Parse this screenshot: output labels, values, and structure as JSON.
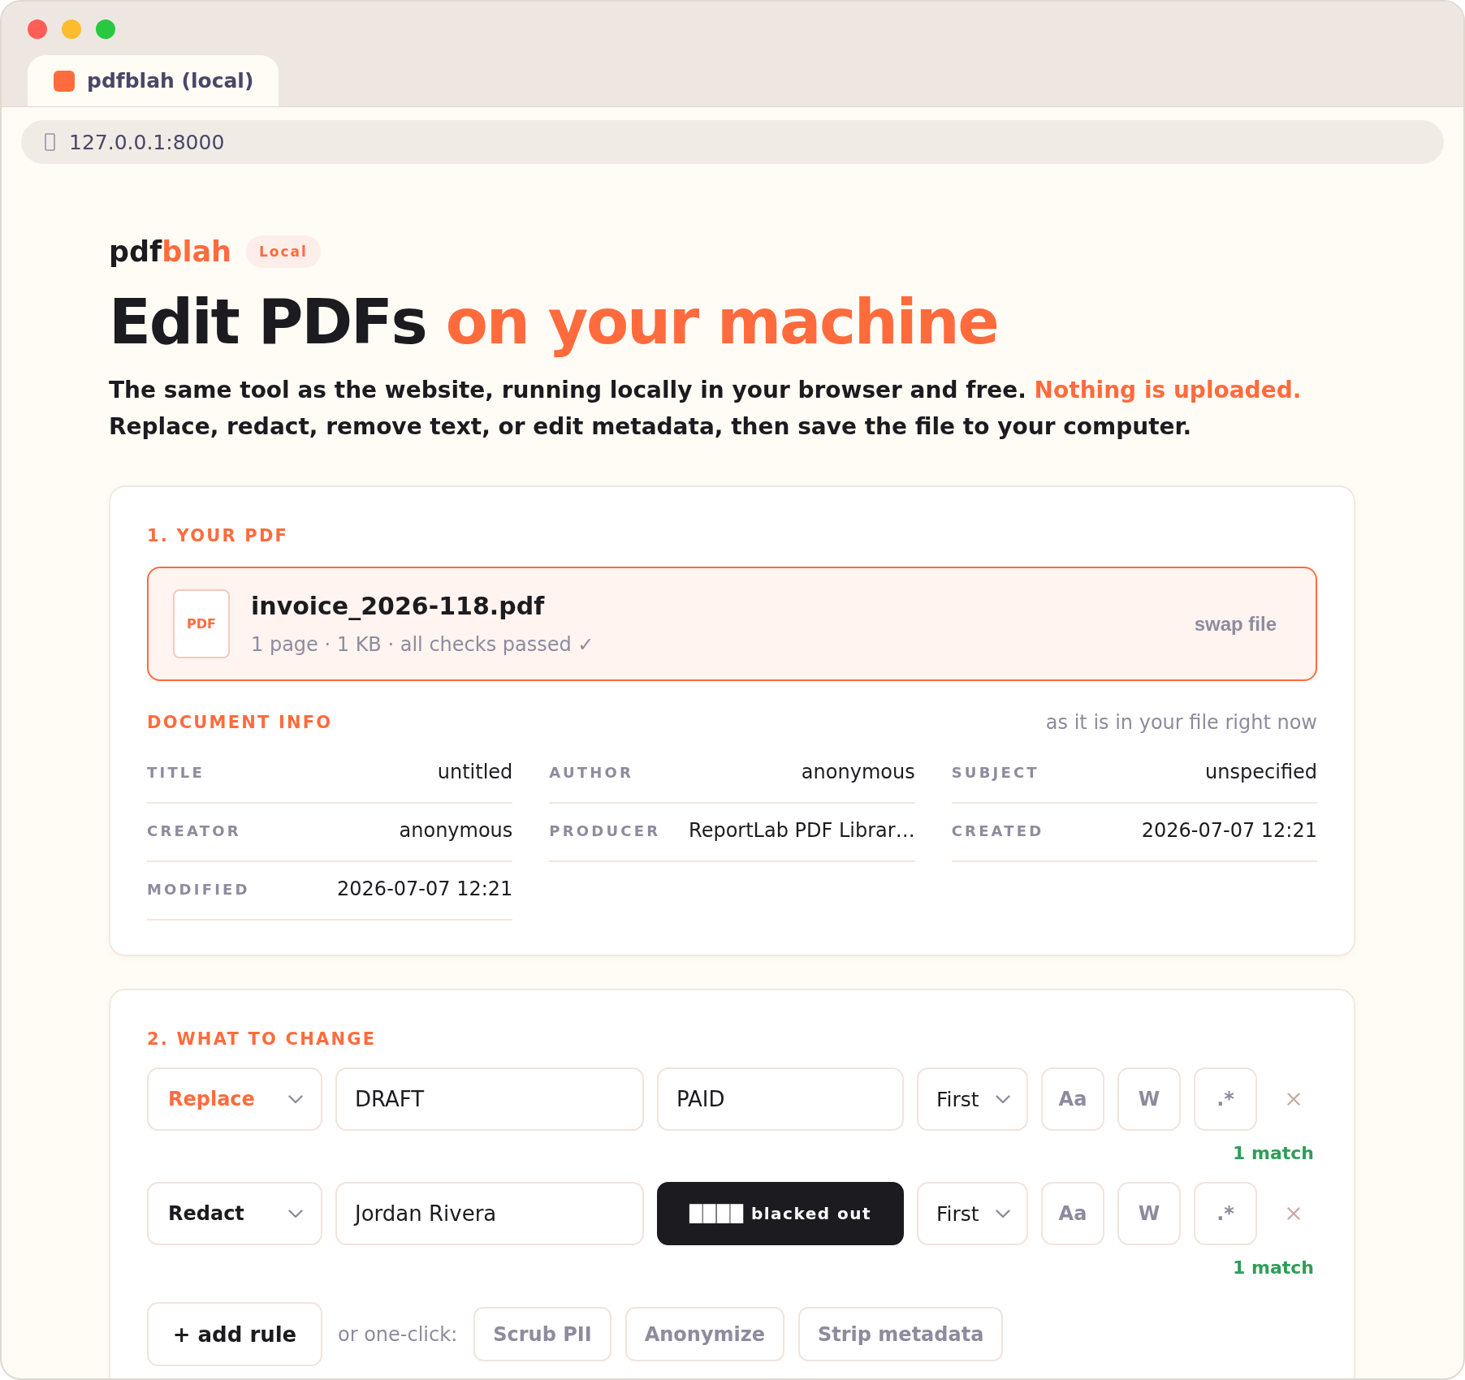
{
  "browser": {
    "tab": {
      "title": "pdfblah (local)",
      "selected": true
    },
    "address_bar": {
      "url": "127.0.0.1:8000"
    }
  },
  "header": {
    "logo": {
      "first": "pdf",
      "second": "blah"
    },
    "badge": "Local",
    "headline": {
      "text": "Edit PDFs",
      "highlight": "on your machine"
    },
    "intro": {
      "text": "The same tool as the website, running locally in your browser and free.",
      "highlight": "Nothing is uploaded.",
      "second_line": "Replace, redact, remove text, or edit metadata, then save the file to your computer."
    }
  },
  "your_pdf": {
    "heading": "1. YOUR PDF",
    "file": {
      "type_label": "PDF",
      "name": "invoice_2026-118.pdf",
      "details": "1 page · 1 KB · all checks passed ✓",
      "action": "swap file"
    },
    "document_info": {
      "heading": "DOCUMENT INFO",
      "note": "as it is in your file right now",
      "fields": [
        {
          "label": "TITLE",
          "value": "untitled"
        },
        {
          "label": "AUTHOR",
          "value": "anonymous"
        },
        {
          "label": "SUBJECT",
          "value": "unspecified"
        },
        {
          "label": "CREATOR",
          "value": "anonymous"
        },
        {
          "label": "PRODUCER",
          "value": "ReportLab PDF Librar…"
        },
        {
          "label": "CREATED",
          "value": "2026-07-07 12:21"
        },
        {
          "label": "MODIFIED",
          "value": "2026-07-07 12:21"
        }
      ]
    }
  },
  "what_to_change": {
    "heading": "2. WHAT TO CHANGE",
    "rules": [
      {
        "kind": "replace",
        "action": "Replace",
        "find": "DRAFT",
        "replacement": "PAID",
        "scope": "First",
        "toggles": [
          {
            "label": "Aa",
            "on": false
          },
          {
            "label": "W",
            "on": false
          },
          {
            "label": ".*",
            "on": false
          }
        ],
        "matches": "1 match"
      },
      {
        "kind": "redact",
        "action": "Redact",
        "find": "Jordan Rivera",
        "replacement": "████ blacked out",
        "scope": "First",
        "toggles": [
          {
            "label": "Aa",
            "on": false
          },
          {
            "label": "W",
            "on": false
          },
          {
            "label": ".*",
            "on": false
          }
        ],
        "matches": "1 match"
      }
    ],
    "add_rule": "+ add rule",
    "presets_label": "or one-click:",
    "presets": [
      "Scrub PII",
      "Anonymize",
      "Strip metadata"
    ]
  }
}
